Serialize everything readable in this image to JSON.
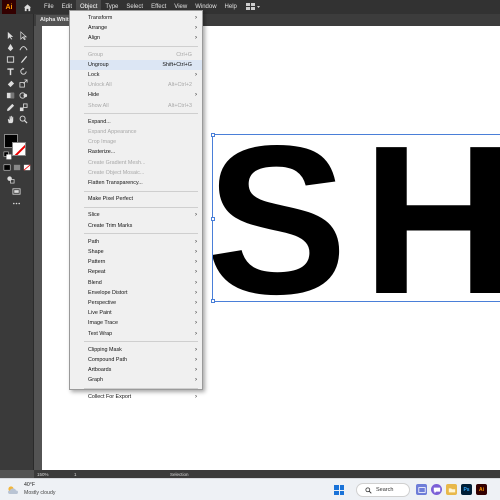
{
  "app": {
    "logo_text": "Ai",
    "menus": [
      "File",
      "Edit",
      "Object",
      "Type",
      "Select",
      "Effect",
      "View",
      "Window",
      "Help"
    ],
    "active_menu": "Object",
    "document_tab": "Alpha White"
  },
  "artwork": {
    "letter_1": "S",
    "letter_2": "H",
    "fill_color": "#000000",
    "selection_color": "#4a7fd8"
  },
  "object_menu": {
    "items": [
      {
        "label": "Transform",
        "shortcut": "",
        "submenu": true,
        "disabled": false
      },
      {
        "label": "Arrange",
        "shortcut": "",
        "submenu": true,
        "disabled": false
      },
      {
        "label": "Align",
        "shortcut": "",
        "submenu": true,
        "disabled": false
      },
      {
        "label": "Group",
        "shortcut": "Ctrl+G",
        "submenu": false,
        "disabled": true
      },
      {
        "label": "Ungroup",
        "shortcut": "Shift+Ctrl+G",
        "submenu": false,
        "disabled": false
      },
      {
        "label": "Lock",
        "shortcut": "",
        "submenu": true,
        "disabled": false
      },
      {
        "label": "Unlock All",
        "shortcut": "Alt+Ctrl+2",
        "submenu": false,
        "disabled": true
      },
      {
        "label": "Hide",
        "shortcut": "",
        "submenu": true,
        "disabled": false
      },
      {
        "label": "Show All",
        "shortcut": "Alt+Ctrl+3",
        "submenu": false,
        "disabled": true
      },
      {
        "label": "Expand...",
        "shortcut": "",
        "submenu": false,
        "disabled": false
      },
      {
        "label": "Expand Appearance",
        "shortcut": "",
        "submenu": false,
        "disabled": true
      },
      {
        "label": "Crop Image",
        "shortcut": "",
        "submenu": false,
        "disabled": true
      },
      {
        "label": "Rasterize...",
        "shortcut": "",
        "submenu": false,
        "disabled": false
      },
      {
        "label": "Create Gradient Mesh...",
        "shortcut": "",
        "submenu": false,
        "disabled": true
      },
      {
        "label": "Create Object Mosaic...",
        "shortcut": "",
        "submenu": false,
        "disabled": true
      },
      {
        "label": "Flatten Transparency...",
        "shortcut": "",
        "submenu": false,
        "disabled": false
      },
      {
        "label": "Make Pixel Perfect",
        "shortcut": "",
        "submenu": false,
        "disabled": false
      },
      {
        "label": "Slice",
        "shortcut": "",
        "submenu": true,
        "disabled": false
      },
      {
        "label": "Create Trim Marks",
        "shortcut": "",
        "submenu": false,
        "disabled": false
      },
      {
        "label": "Path",
        "shortcut": "",
        "submenu": true,
        "disabled": false
      },
      {
        "label": "Shape",
        "shortcut": "",
        "submenu": true,
        "disabled": false
      },
      {
        "label": "Pattern",
        "shortcut": "",
        "submenu": true,
        "disabled": false
      },
      {
        "label": "Repeat",
        "shortcut": "",
        "submenu": true,
        "disabled": false
      },
      {
        "label": "Blend",
        "shortcut": "",
        "submenu": true,
        "disabled": false
      },
      {
        "label": "Envelope Distort",
        "shortcut": "",
        "submenu": true,
        "disabled": false
      },
      {
        "label": "Perspective",
        "shortcut": "",
        "submenu": true,
        "disabled": false
      },
      {
        "label": "Live Paint",
        "shortcut": "",
        "submenu": true,
        "disabled": false
      },
      {
        "label": "Image Trace",
        "shortcut": "",
        "submenu": true,
        "disabled": false
      },
      {
        "label": "Text Wrap",
        "shortcut": "",
        "submenu": true,
        "disabled": false
      },
      {
        "label": "Clipping Mask",
        "shortcut": "",
        "submenu": true,
        "disabled": false
      },
      {
        "label": "Compound Path",
        "shortcut": "",
        "submenu": true,
        "disabled": false
      },
      {
        "label": "Artboards",
        "shortcut": "",
        "submenu": true,
        "disabled": false
      },
      {
        "label": "Graph",
        "shortcut": "",
        "submenu": true,
        "disabled": false
      },
      {
        "label": "Collect For Export",
        "shortcut": "",
        "submenu": true,
        "disabled": false
      }
    ],
    "hovered_item": "Ungroup"
  },
  "status_bar": {
    "zoom": "150%",
    "artboard_number": "1",
    "tool_name": "Selection"
  },
  "taskbar": {
    "weather_temp": "40°F",
    "weather_desc": "Mostly cloudy",
    "search_label": "Search",
    "ps_label": "Ps",
    "ai_label": "Ai"
  }
}
